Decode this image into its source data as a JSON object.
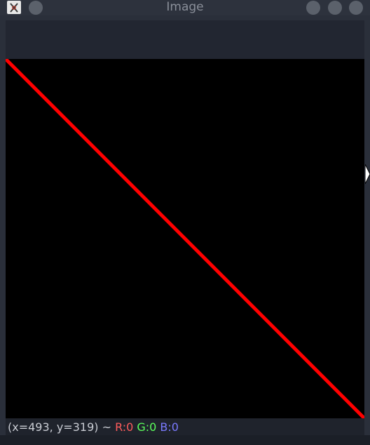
{
  "window": {
    "title": "Image"
  },
  "icons": {
    "app": "opencv-logo-icon",
    "window_buttons": [
      "minimize-icon",
      "maximize-icon",
      "close-icon"
    ],
    "menu_button": "window-menu-icon",
    "cursor": "mouse-pointer-icon"
  },
  "canvas": {
    "background": "#000000",
    "line": {
      "color": "#ff0000",
      "description_from": "top-left",
      "to": "bottom-right"
    }
  },
  "status": {
    "coords": "(x=493, y=319) ~ ",
    "r": "R:0",
    "g": "G:0",
    "b": "B:0"
  },
  "colors": {
    "status_r": "#ff5c5c",
    "status_g": "#5cff5c",
    "status_b": "#7a7aff"
  }
}
